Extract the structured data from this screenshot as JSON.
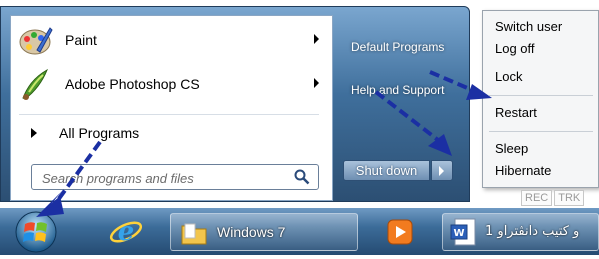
{
  "colors": {
    "annotation_arrow": "#1b2fa3",
    "taskbar": "#3c6c99",
    "menu_frame": "#3f6f9c"
  },
  "start_menu": {
    "programs": [
      {
        "label": "Paint",
        "icon": "paint-icon",
        "has_submenu": true
      },
      {
        "label": "Adobe Photoshop CS",
        "icon": "photoshop-icon",
        "has_submenu": true
      }
    ],
    "all_programs_label": "All Programs",
    "search": {
      "placeholder": "Search programs and files",
      "icon": "search-icon"
    },
    "right_links": [
      "Default Programs",
      "Help and Support"
    ],
    "shutdown_label": "Shut down"
  },
  "power_menu": {
    "items": [
      "Switch user",
      "Log off",
      "Lock",
      "Restart",
      "Sleep",
      "Hibernate"
    ]
  },
  "rec_trk": [
    "REC",
    "TRK"
  ],
  "taskbar": {
    "explorer_label": "Windows 7",
    "word_label": "و کتیب دانڤتراو 1"
  }
}
